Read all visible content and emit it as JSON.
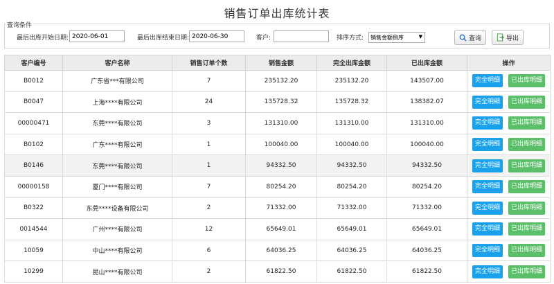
{
  "title": "销售订单出库统计表",
  "query": {
    "legend": "查询条件",
    "start_label": "最后出库开始日期:",
    "start_value": "2020-06-01",
    "end_label": "最后出库结束日期:",
    "end_value": "2020-06-30",
    "customer_label": "客户:",
    "customer_value": "",
    "sort_label": "排序方式:",
    "sort_value": "销售金额倒序",
    "search_label": "查询",
    "export_label": "导出"
  },
  "table": {
    "headers": [
      "客户编号",
      "客户名称",
      "销售订单个数",
      "销售金额",
      "完全出库金额",
      "已出库金额",
      "操作"
    ],
    "full_detail_label": "完全明细",
    "out_detail_label": "已出库明细",
    "rows": [
      {
        "code": "B0012",
        "name": "广东省***有限公司",
        "count": "7",
        "sales": "235132.20",
        "full": "235132.20",
        "out": "143507.00"
      },
      {
        "code": "B0047",
        "name": "上海****有限公司",
        "count": "24",
        "sales": "135728.32",
        "full": "135728.32",
        "out": "138382.07"
      },
      {
        "code": "00000471",
        "name": "东莞****有限公司",
        "count": "3",
        "sales": "131310.00",
        "full": "131310.00",
        "out": "131310.00"
      },
      {
        "code": "B0102",
        "name": "广东****有限公司",
        "count": "1",
        "sales": "100040.00",
        "full": "100040.00",
        "out": "100040.00"
      },
      {
        "code": "B0146",
        "name": "东莞****有限公司",
        "count": "1",
        "sales": "94332.50",
        "full": "94332.50",
        "out": "94332.50"
      },
      {
        "code": "00000158",
        "name": "厦门****有限公司",
        "count": "7",
        "sales": "80254.20",
        "full": "80254.20",
        "out": "80254.20"
      },
      {
        "code": "B0322",
        "name": "东莞****设备有限公司",
        "count": "2",
        "sales": "71332.00",
        "full": "71332.00",
        "out": "71332.00"
      },
      {
        "code": "0014544",
        "name": "广州****有限公司",
        "count": "12",
        "sales": "65649.01",
        "full": "65649.01",
        "out": "65649.01"
      },
      {
        "code": "10059",
        "name": "中山****有限公司",
        "count": "6",
        "sales": "64036.25",
        "full": "64036.25",
        "out": "64036.25"
      },
      {
        "code": "10299",
        "name": "昆山****有限公司",
        "count": "2",
        "sales": "61822.50",
        "full": "61822.50",
        "out": "61822.50"
      }
    ]
  }
}
